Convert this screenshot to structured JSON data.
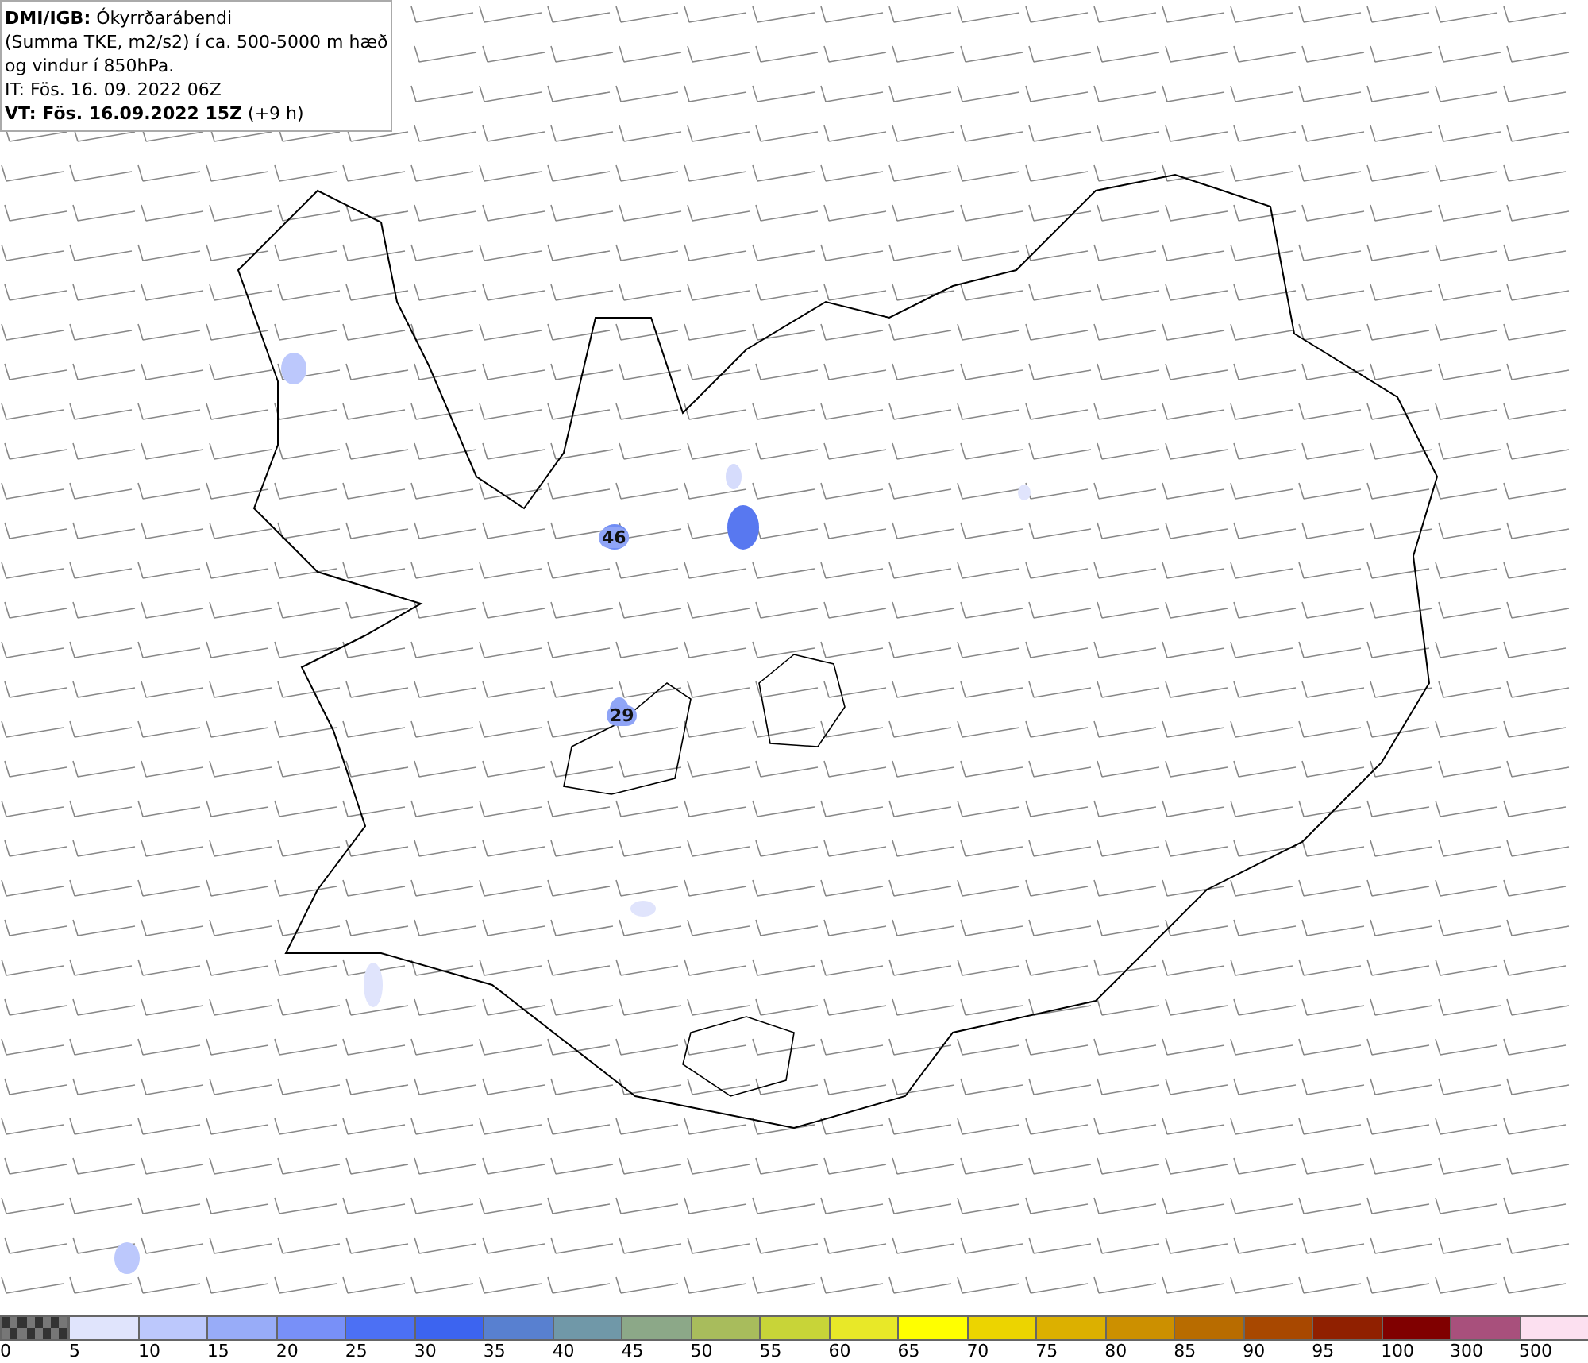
{
  "legend": {
    "lines": [
      "**DMI/IGB:** Ókyrrðarábendi",
      "(Summa TKE, m2/s2) í ca. 500-5000 m hæð",
      "og vindur í 850hPa.",
      "IT: Fös. 16. 09. 2022 06Z",
      "**VT: Fös. 16.09.2022 15Z** (+9 h)"
    ]
  },
  "map_labels": [
    {
      "text": "46"
    },
    {
      "text": "29"
    }
  ],
  "colorbar": [
    {
      "kind": "checker",
      "label": "0"
    },
    {
      "kind": "solid",
      "color": "#e0e4fc",
      "label": "5"
    },
    {
      "kind": "solid",
      "color": "#bcc8fc",
      "label": "10"
    },
    {
      "kind": "solid",
      "color": "#98acf8",
      "label": "15"
    },
    {
      "kind": "solid",
      "color": "#7890f8",
      "label": "20"
    },
    {
      "kind": "solid",
      "color": "#4c70f4",
      "label": "25"
    },
    {
      "kind": "solid",
      "color": "#3c64f0",
      "label": "30"
    },
    {
      "kind": "solid",
      "color": "#5880d0",
      "label": "35"
    },
    {
      "kind": "solid",
      "color": "#7098a8",
      "label": "40"
    },
    {
      "kind": "solid",
      "color": "#8ca888",
      "label": "45"
    },
    {
      "kind": "solid",
      "color": "#a8bc5c",
      "label": "50"
    },
    {
      "kind": "solid",
      "color": "#c8d438",
      "label": "55"
    },
    {
      "kind": "solid",
      "color": "#e8e828",
      "label": "60"
    },
    {
      "kind": "solid",
      "color": "#ffff00",
      "label": "65"
    },
    {
      "kind": "solid",
      "color": "#ecd400",
      "label": "70"
    },
    {
      "kind": "solid",
      "color": "#dcb000",
      "label": "75"
    },
    {
      "kind": "solid",
      "color": "#cc9000",
      "label": "80"
    },
    {
      "kind": "solid",
      "color": "#b86c00",
      "label": "85"
    },
    {
      "kind": "solid",
      "color": "#a84800",
      "label": "90"
    },
    {
      "kind": "solid",
      "color": "#902000",
      "label": "95"
    },
    {
      "kind": "solid",
      "color": "#800000",
      "label": "100"
    },
    {
      "kind": "solid",
      "color": "#a8507c",
      "label": "300"
    },
    {
      "kind": "solid",
      "color": "#fce0f0",
      "label": "500"
    }
  ]
}
